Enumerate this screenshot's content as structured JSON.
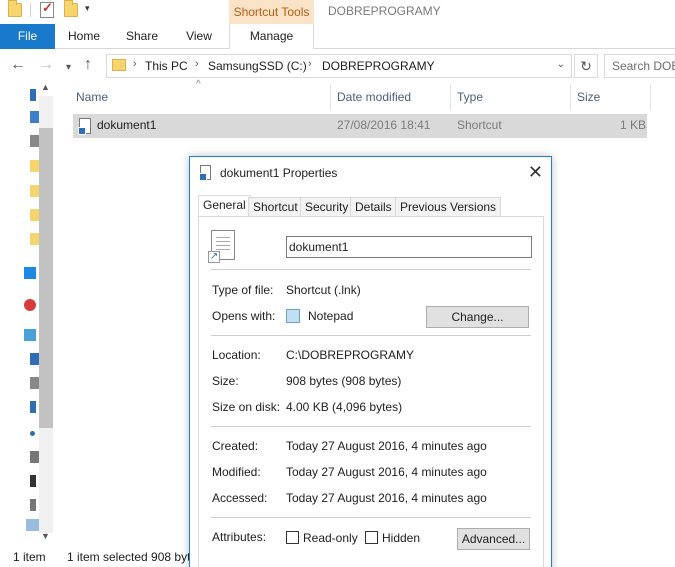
{
  "titlebar": {
    "contextual_group": "Shortcut Tools",
    "window_title": "DOBREPROGRAMY"
  },
  "ribbon": {
    "tabs": [
      "File",
      "Home",
      "Share",
      "View",
      "Manage"
    ]
  },
  "address": {
    "breadcrumbs": [
      "This PC",
      "SamsungSSD (C:)",
      "DOBREPROGRAMY"
    ],
    "search_placeholder": "Search DOB"
  },
  "columns": [
    "Name",
    "Date modified",
    "Type",
    "Size"
  ],
  "files": [
    {
      "name": "dokument1",
      "date_modified": "27/08/2016 18:41",
      "type": "Shortcut",
      "size": "1 KB"
    }
  ],
  "status": {
    "item_count": "1 item",
    "selection": "1 item selected  908 byt"
  },
  "dialog": {
    "title": "dokument1 Properties",
    "close_glyph": "✕",
    "tabs": [
      "General",
      "Shortcut",
      "Security",
      "Details",
      "Previous Versions"
    ],
    "file_name": "dokument1",
    "type_of_file_label": "Type of file:",
    "type_of_file": "Shortcut (.lnk)",
    "opens_with_label": "Opens with:",
    "opens_with": "Notepad",
    "change_button": "Change...",
    "location_label": "Location:",
    "location": "C:\\DOBREPROGRAMY",
    "size_label": "Size:",
    "size": "908 bytes (908 bytes)",
    "size_on_disk_label": "Size on disk:",
    "size_on_disk": "4.00 KB (4,096 bytes)",
    "created_label": "Created:",
    "created": "Today 27 August 2016, 4 minutes ago",
    "modified_label": "Modified:",
    "modified": "Today 27 August 2016, 4 minutes ago",
    "accessed_label": "Accessed:",
    "accessed": "Today 27 August 2016, 4 minutes ago",
    "attributes_label": "Attributes:",
    "readonly_label": "Read-only",
    "hidden_label": "Hidden",
    "advanced_button": "Advanced..."
  },
  "colors": {
    "file_tab": "#1979ca",
    "contextual_tab": "#fbe3c7",
    "contextual_text": "#b75d12",
    "selection_row": "#d9d9d9",
    "dialog_border": "#1883d7"
  }
}
